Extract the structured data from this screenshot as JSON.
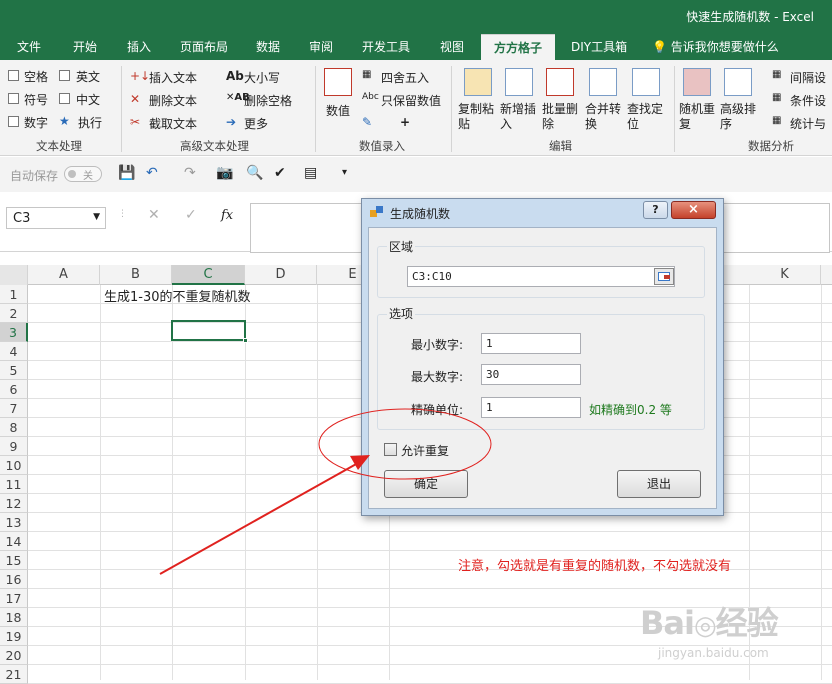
{
  "app": {
    "title": "快速生成随机数  -  Excel"
  },
  "tabs": [
    "文件",
    "开始",
    "插入",
    "页面布局",
    "数据",
    "审阅",
    "开发工具",
    "视图",
    "方方格子",
    "DIY工具箱",
    "告诉我你想要做什么"
  ],
  "ribbon": {
    "text_group": {
      "items": [
        "空格",
        "英文",
        "符号",
        "中文",
        "数字",
        "执行"
      ],
      "label": "文本处理"
    },
    "adv_text_group": {
      "items": [
        "插入文本",
        "大小写",
        "删除文本",
        "删除空格",
        "截取文本",
        "更多"
      ],
      "label": "高级文本处理"
    },
    "numeric_group": {
      "value_label": "数值",
      "items": [
        "四舍五入",
        "只保留数值"
      ],
      "label": "数值录入"
    },
    "edit_group": {
      "items": [
        "复制粘贴",
        "新增插入",
        "批量删除",
        "合并转换",
        "查找定位"
      ],
      "label": "编辑"
    },
    "analysis_group": {
      "items": [
        "随机重复",
        "高级排序",
        "间隔设",
        "条件设",
        "统计与"
      ],
      "label": "数据分析"
    }
  },
  "qat": {
    "autosave_label": "自动保存",
    "autosave_state": "关"
  },
  "formula_bar": {
    "name_box": "C3",
    "fx": "fx"
  },
  "sheet": {
    "columns": [
      "A",
      "B",
      "C",
      "D",
      "E",
      "K"
    ],
    "rows": [
      "1",
      "2",
      "3",
      "4",
      "5",
      "6",
      "7",
      "8",
      "9",
      "10",
      "11",
      "12",
      "13",
      "14",
      "15",
      "16",
      "17",
      "18",
      "19",
      "20",
      "21"
    ],
    "b1_text": "生成1-30的不重复随机数"
  },
  "dialog": {
    "title": "生成随机数",
    "help": "?",
    "close": "×",
    "area_legend": "区域",
    "area_value": "C3:C10",
    "options_legend": "选项",
    "min_label": "最小数字:",
    "min_value": "1",
    "max_label": "最大数字:",
    "max_value": "30",
    "precision_label": "精确单位:",
    "precision_value": "1",
    "precision_hint": "如精确到0.2 等",
    "allow_duplicates_label": "允许重复",
    "allow_duplicates_checked": false,
    "ok_label": "确定",
    "cancel_label": "退出"
  },
  "annotation": {
    "text": "注意，勾选就是有重复的随机数，不勾选就没有"
  },
  "watermark": {
    "text": "Baidu经验",
    "sub": "jingyan.baidu.com"
  },
  "colors": {
    "excel_green": "#217346",
    "annotation_red": "#e0221f",
    "hint_green": "#1f7a1f"
  }
}
